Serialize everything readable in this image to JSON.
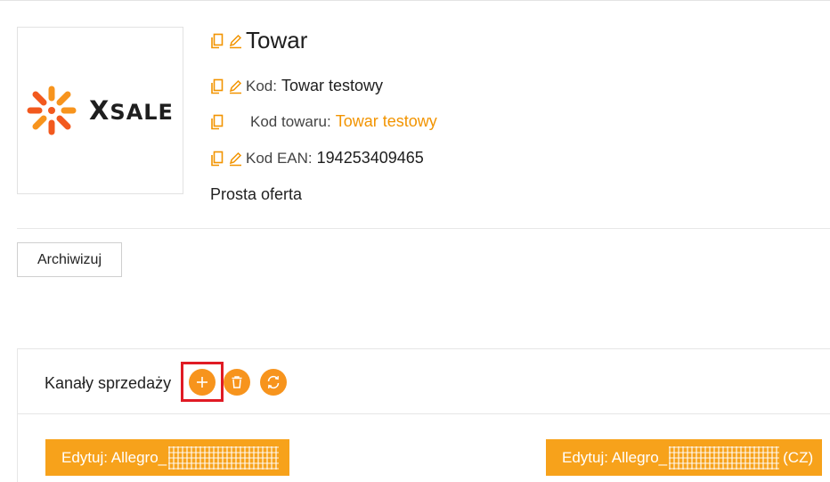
{
  "product": {
    "title": "Towar",
    "kod_label": "Kod:",
    "kod_value": "Towar testowy",
    "kod_towaru_label": "Kod towaru:",
    "kod_towaru_value": "Towar testowy",
    "ean_label": "Kod EAN:",
    "ean_value": "194253409465",
    "offer_type": "Prosta oferta"
  },
  "logo": {
    "text": "XSALE",
    "accent_color": "#f2591e",
    "accent_color_2": "#f7941d"
  },
  "actions": {
    "archive_label": "Archiwizuj"
  },
  "channels": {
    "title": "Kanały sprzedaży",
    "add_icon": "plus-icon",
    "delete_icon": "trash-icon",
    "refresh_icon": "refresh-icon",
    "edit_buttons": [
      {
        "prefix": "Edytuj: Allegro_",
        "suffix": ""
      },
      {
        "prefix": "Edytuj: Allegro_",
        "suffix": "(CZ)"
      }
    ]
  },
  "colors": {
    "accent": "#f7941d",
    "button": "#f7a21b",
    "highlight": "#e01b24",
    "link": "#f29400"
  }
}
